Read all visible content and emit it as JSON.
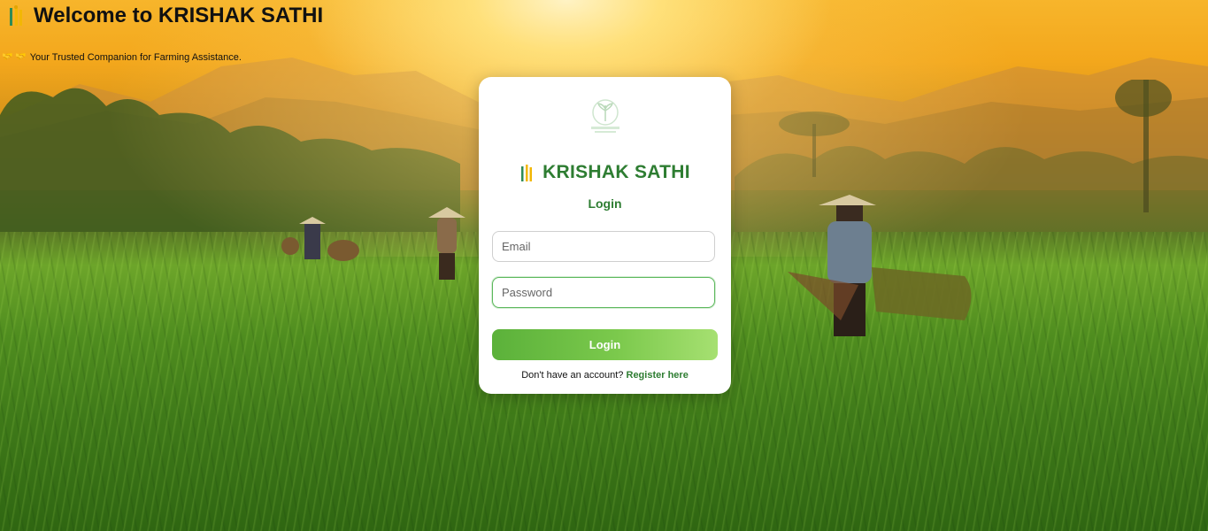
{
  "header": {
    "title": "Welcome to KRISHAK SATHI",
    "tagline": "Your Trusted Companion for Farming Assistance.",
    "tagline_icons": "🤝 🤝"
  },
  "card": {
    "brand_name": "KRISHAK SATHI",
    "heading": "Login",
    "email": {
      "placeholder": "Email",
      "value": ""
    },
    "password": {
      "placeholder": "Password",
      "value": ""
    },
    "login_button": "Login",
    "register_prompt": "Don't have an account?",
    "register_link": "Register here"
  },
  "colors": {
    "brand_green": "#2e7d32",
    "button_start": "#5bb13a",
    "button_end": "#a6e071",
    "focus_border": "#5cb85c"
  },
  "icons": {
    "logo": "wheat-icon",
    "card_logo": "leaf-seal-icon",
    "tagline": "handshake-icon"
  }
}
